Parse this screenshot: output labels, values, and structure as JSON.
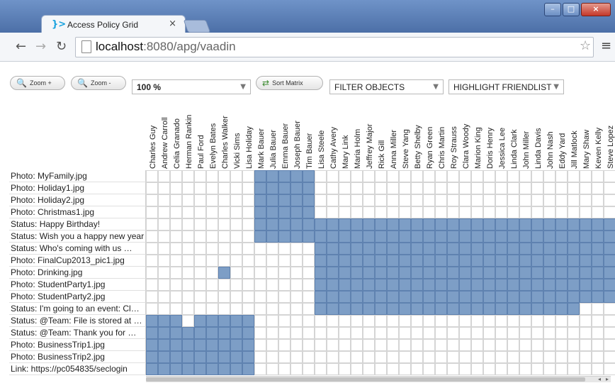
{
  "browser": {
    "tab_title": "Access Policy Grid",
    "tab_close": "×",
    "favicon": "}>",
    "url_host": "localhost",
    "url_path": ":8080/apg/vaadin",
    "back": "←",
    "forward": "→",
    "reload": "↻",
    "star": "☆",
    "menu": "≡",
    "win_minimize": "–",
    "win_maximize": "□",
    "win_close": "×"
  },
  "toolbar": {
    "zoom_in_label": "Zoom +",
    "zoom_out_label": "Zoom -",
    "zoom_value": "100 %",
    "sort_label": "Sort Matrix",
    "filter_label": "FILTER OBJECTS",
    "highlight_label": "HIGHLIGHT FRIENDLIST"
  },
  "columns": [
    "Charles Guy",
    "Andrew Carroll",
    "Celia Granado",
    "Herman Rankin",
    "Paul Ford",
    "Evelyn Bates",
    "Charles Walker",
    "Vicki Sims",
    "Lisa Holiday",
    "Mark Bauer",
    "Julia Bauer",
    "Emma Bauer",
    "Joseph Bauer",
    "Tim Bauer",
    "Lisa Steele",
    "Cathy Avery",
    "Mary Link",
    "Maria Holm",
    "Jeffrey Major",
    "Rick Gill",
    "Anna Miller",
    "Steve Yang",
    "Betty Shelby",
    "Ryan Green",
    "Chris Martin",
    "Roy Strauss",
    "Clara Woody",
    "Marion King",
    "Doris Henry",
    "Jessica Lee",
    "Linda Clark",
    "John Miller",
    "Linda Davis",
    "John Nash",
    "Eddy Yard",
    "Jill Matlock",
    "Mary Shaw",
    "Keven Kelly",
    "Steve Lopez"
  ],
  "rows": [
    {
      "label": "Photo: MyFamily.jpg",
      "on": [
        [
          9,
          13
        ]
      ]
    },
    {
      "label": "Photo: Holiday1.jpg",
      "on": [
        [
          9,
          13
        ]
      ]
    },
    {
      "label": "Photo: Holiday2.jpg",
      "on": [
        [
          9,
          13
        ]
      ]
    },
    {
      "label": "Photo: Christmas1.jpg",
      "on": [
        [
          9,
          13
        ]
      ]
    },
    {
      "label": "Status: Happy Birthday!",
      "on": [
        [
          9,
          38
        ]
      ]
    },
    {
      "label": "Status: Wish you a happy new year",
      "on": [
        [
          9,
          38
        ]
      ]
    },
    {
      "label": "Status: Who's coming with us …",
      "on": [
        [
          14,
          38
        ]
      ]
    },
    {
      "label": "Photo: FinalCup2013_pic1.jpg",
      "on": [
        [
          14,
          38
        ]
      ]
    },
    {
      "label": "Photo: Drinking.jpg",
      "on": [
        [
          6,
          6
        ],
        [
          14,
          38
        ]
      ]
    },
    {
      "label": "Photo: StudentParty1.jpg",
      "on": [
        [
          14,
          38
        ]
      ]
    },
    {
      "label": "Photo: StudentParty2.jpg",
      "on": [
        [
          14,
          38
        ]
      ]
    },
    {
      "label": "Status: I'm going to an event: Cl…",
      "on": [
        [
          14,
          35
        ]
      ]
    },
    {
      "label": "Status: @Team: File is stored at …",
      "on": [
        [
          0,
          2
        ],
        [
          4,
          8
        ]
      ]
    },
    {
      "label": "Status: @Team: Thank you for …",
      "on": [
        [
          0,
          8
        ]
      ]
    },
    {
      "label": "Photo: BusinessTrip1.jpg",
      "on": [
        [
          0,
          8
        ]
      ]
    },
    {
      "label": "Photo: BusinessTrip2.jpg",
      "on": [
        [
          0,
          8
        ]
      ]
    },
    {
      "label": "Link: https://pc054835/seclogin",
      "on": [
        [
          0,
          8
        ]
      ]
    }
  ],
  "colors": {
    "on": "#7d9ec6"
  }
}
